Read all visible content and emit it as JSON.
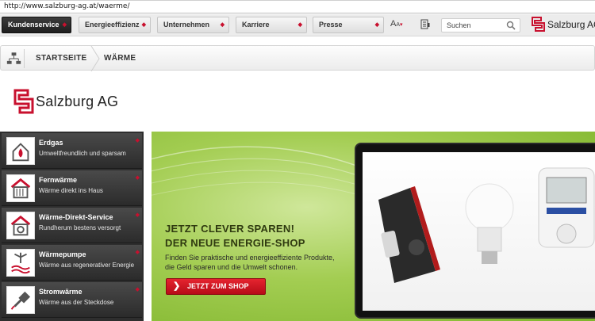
{
  "browser": {
    "url": "http://www.salzburg-ag.at/waerme/"
  },
  "nav": {
    "items": [
      "Kundenservice",
      "Energieeffizienz",
      "Unternehmen",
      "Karriere",
      "Presse"
    ],
    "font_size_icon": "font-size-icon",
    "search_placeholder": "Suchen"
  },
  "brand": {
    "name": "Salzburg AG",
    "accent": "#c8102e"
  },
  "breadcrumb": {
    "items": [
      "STARTSEITE",
      "WÄRME"
    ]
  },
  "sidebar": {
    "items": [
      {
        "title": "Erdgas",
        "subtitle": "Umweltfreundlich und sparsam",
        "icon": "gas-flame-house-icon"
      },
      {
        "title": "Fernwärme",
        "subtitle": "Wärme direkt ins Haus",
        "icon": "district-heating-icon"
      },
      {
        "title": "Wärme-Direkt-Service",
        "subtitle": "Rundherum bestens versorgt",
        "icon": "heat-service-icon"
      },
      {
        "title": "Wärmepumpe",
        "subtitle": "Wärme aus regenerativer Energie",
        "icon": "heat-pump-icon"
      },
      {
        "title": "Stromwärme",
        "subtitle": "Wärme aus der Steckdose",
        "icon": "electric-plug-icon"
      }
    ]
  },
  "banner": {
    "headline_1": "JETZT CLEVER SPAREN!",
    "headline_2": "DER NEUE ENERGIE-SHOP",
    "text_1": "Finden Sie praktische und energieeffiziente Produkte,",
    "text_2": "die Geld sparen und die Umwelt schonen.",
    "button": "JETZT ZUM SHOP"
  }
}
